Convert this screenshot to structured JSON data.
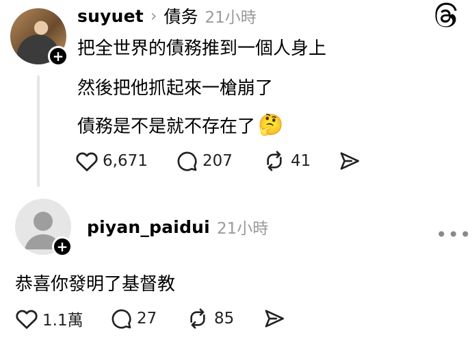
{
  "post1": {
    "username": "suyuet",
    "topic": "債务",
    "time": "21小時",
    "lines": [
      "把全世界的債務推到一個人身上",
      "然後把他抓起來一槍崩了",
      "債務是不是就不存在了"
    ],
    "emoji": "🤔",
    "likes": "6,671",
    "replies": "207",
    "reposts": "41"
  },
  "post2": {
    "username": "piyan_paidui",
    "time": "21小時",
    "text": "恭喜你發明了基督教",
    "likes": "1.1萬",
    "replies": "27",
    "reposts": "85"
  },
  "icons": {
    "logo": "threads-logo-icon",
    "like": "heart-icon",
    "reply": "comment-icon",
    "repost": "repost-icon",
    "share": "send-icon",
    "follow": "plus-icon",
    "more": "more-dots-icon"
  }
}
